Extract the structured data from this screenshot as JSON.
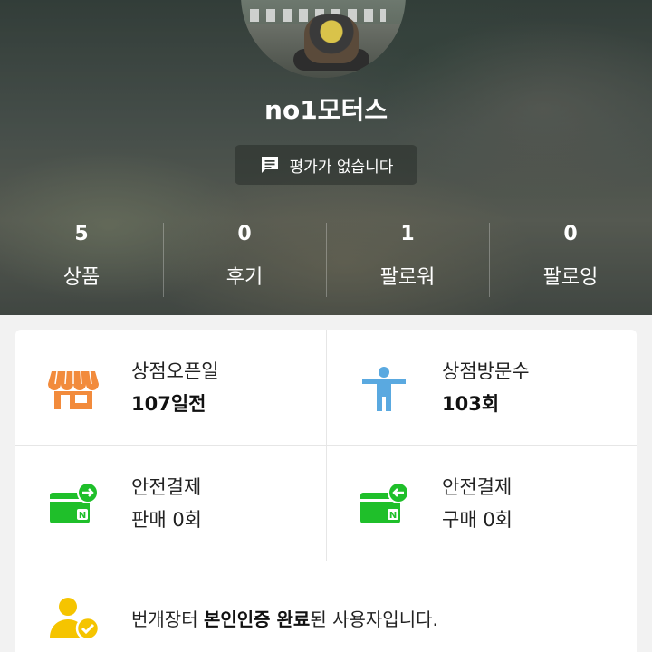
{
  "profile": {
    "shop_name": "no1모터스",
    "rating_text": "평가가 없습니다"
  },
  "stats": [
    {
      "count": "5",
      "label": "상품"
    },
    {
      "count": "0",
      "label": "후기"
    },
    {
      "count": "1",
      "label": "팔로워"
    },
    {
      "count": "0",
      "label": "팔로잉"
    }
  ],
  "info": {
    "open": {
      "title": "상점오픈일",
      "value": "107일전"
    },
    "visits": {
      "title": "상점방문수",
      "value": "103회"
    },
    "safe_sell": {
      "title": "안전결제",
      "value": "판매 0회"
    },
    "safe_buy": {
      "title": "안전결제",
      "value": "구매 0회"
    }
  },
  "verification": {
    "prefix": "번개장터 ",
    "highlight": "본인인증 완료",
    "suffix": "된 사용자입니다."
  },
  "colors": {
    "store_icon": "#f28b3c",
    "visitor_icon": "#5aa9e0",
    "pay_icon": "#1fbf2a",
    "verify_icon": "#f5c400"
  },
  "icons": {
    "store": "store-icon",
    "visitor": "person-icon",
    "pay": "wallet-icon",
    "verify": "verified-user-icon",
    "rating": "message-icon"
  }
}
